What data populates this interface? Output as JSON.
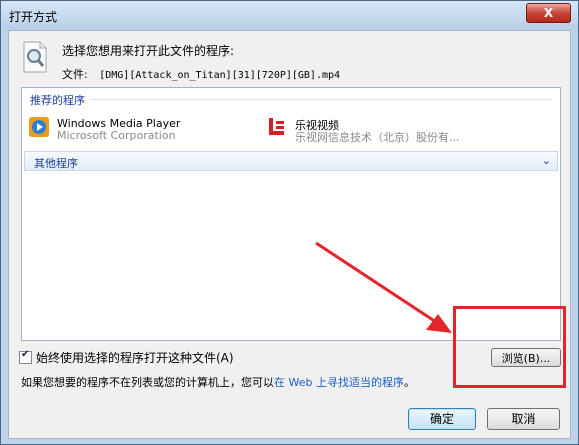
{
  "window": {
    "title": "打开方式",
    "close_label": "X"
  },
  "header": {
    "prompt": "选择您想用来打开此文件的程序:",
    "file_label": "文件:",
    "file_name": "[DMG][Attack_on_Titan][31][720P][GB].mp4"
  },
  "recommended": {
    "label": "推荐的程序",
    "programs": [
      {
        "name": "Windows Media Player",
        "publisher": "Microsoft Corporation",
        "icon": "media-player-icon"
      },
      {
        "name": "乐视视频",
        "publisher": "乐视网信息技术（北京）股份有...",
        "icon": "letv-icon"
      }
    ]
  },
  "other": {
    "label": "其他程序"
  },
  "options": {
    "always_use_label": "始终使用选择的程序打开这种文件(A)",
    "always_use_checked": true
  },
  "browse": {
    "label": "浏览(B)..."
  },
  "hint": {
    "prefix": "如果您想要的程序不在列表或您的计算机上，您可以",
    "link": "在 Web 上寻找适当的程序",
    "suffix": "。"
  },
  "buttons": {
    "ok": "确定",
    "cancel": "取消"
  },
  "colors": {
    "annotation": "#e5242a",
    "link": "#1a5fc9",
    "group_header": "#1e3f9b"
  }
}
